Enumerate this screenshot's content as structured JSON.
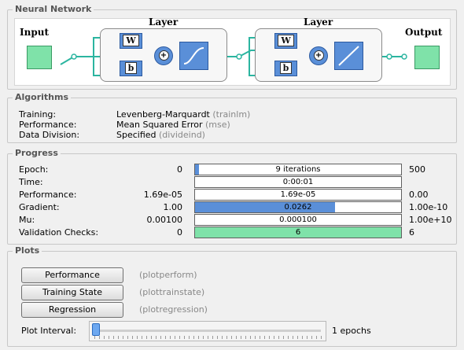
{
  "neural_network": {
    "title": "Neural Network",
    "input_label": "Input",
    "output_label": "Output",
    "layers": [
      {
        "title": "Layer",
        "w": "W",
        "b": "b",
        "activation": "sigmoid"
      },
      {
        "title": "Layer",
        "w": "W",
        "b": "b",
        "activation": "linear"
      }
    ],
    "plus_symbol": "+"
  },
  "algorithms": {
    "title": "Algorithms",
    "rows": [
      {
        "key": "Training:",
        "value": "Levenberg-Marquardt",
        "fn": "(trainlm)"
      },
      {
        "key": "Performance:",
        "value": "Mean Squared Error",
        "fn": "(mse)"
      },
      {
        "key": "Data Division:",
        "value": "Specified",
        "fn": "(divideind)"
      }
    ]
  },
  "progress": {
    "title": "Progress",
    "rows": [
      {
        "label": "Epoch:",
        "min": "0",
        "bar_text": "9 iterations",
        "max": "500",
        "fill": 0.018,
        "fill_color": "#5a8fd8"
      },
      {
        "label": "Time:",
        "min": "",
        "bar_text": "0:00:01",
        "max": "",
        "fill": 0,
        "fill_color": "#5a8fd8"
      },
      {
        "label": "Performance:",
        "min": "1.69e-05",
        "bar_text": "1.69e-05",
        "max": "0.00",
        "fill": 0,
        "fill_color": "#5a8fd8"
      },
      {
        "label": "Gradient:",
        "min": "1.00",
        "bar_text": "0.0262",
        "max": "1.00e-10",
        "fill": 0.68,
        "fill_color": "#5a8fd8"
      },
      {
        "label": "Mu:",
        "min": "0.00100",
        "bar_text": "0.000100",
        "max": "1.00e+10",
        "fill": 0,
        "fill_color": "#5a8fd8"
      },
      {
        "label": "Validation Checks:",
        "min": "0",
        "bar_text": "6",
        "max": "6",
        "fill": 1.0,
        "fill_color": "#7fe2a9"
      }
    ]
  },
  "plots": {
    "title": "Plots",
    "buttons": [
      {
        "label": "Performance",
        "fn": "(plotperform)"
      },
      {
        "label": "Training State",
        "fn": "(plottrainstate)"
      },
      {
        "label": "Regression",
        "fn": "(plotregression)"
      }
    ],
    "interval_label": "Plot Interval:",
    "interval_value": "1 epochs",
    "slider_level": 0.0
  }
}
